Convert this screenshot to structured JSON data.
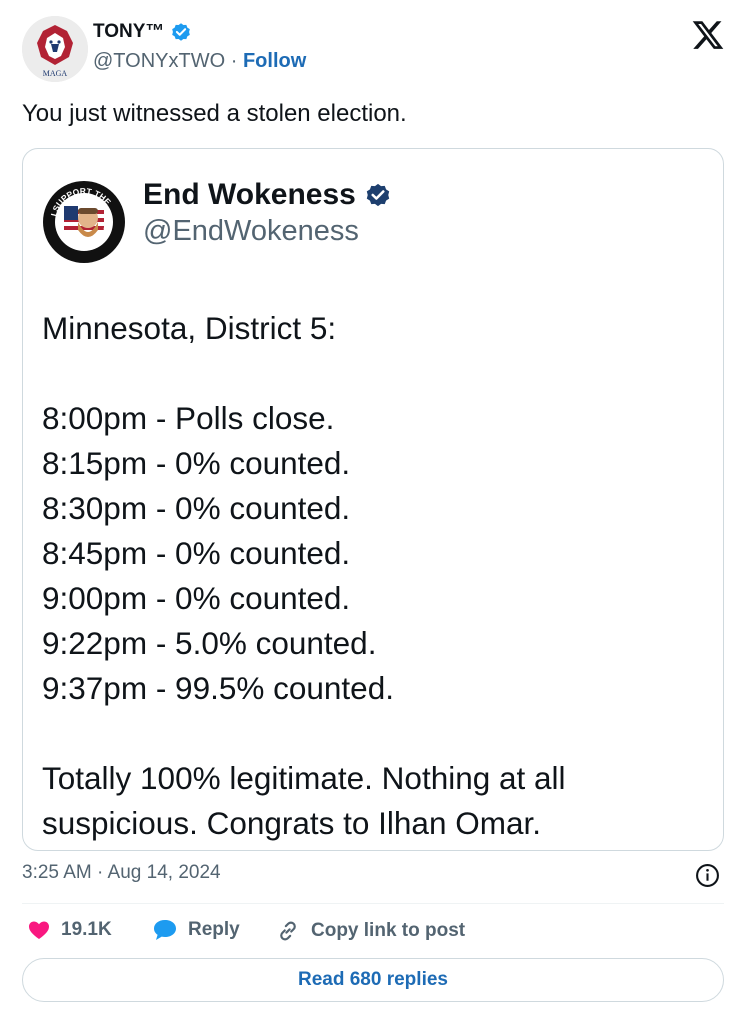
{
  "author": {
    "name": "TONY™",
    "handle": "@TONYxTWO",
    "separator": "·",
    "follow_label": "Follow",
    "avatar_caption": "MAGA"
  },
  "tweet": {
    "text": "You just witnessed a stolen election."
  },
  "quoted": {
    "name": "End Wokeness",
    "handle": "@EndWokeness",
    "avatar_text_top": "I SUPPORT THE",
    "avatar_text_bottom": "FORMER THINGS",
    "lines": [
      "Minnesota, District 5:",
      "",
      "8:00pm - Polls close.",
      "8:15pm - 0% counted.",
      "8:30pm - 0% counted.",
      "8:45pm - 0% counted.",
      "9:00pm - 0% counted.",
      "9:22pm - 5.0% counted.",
      "9:37pm - 99.5% counted.",
      "",
      "Totally 100% legitimate. Nothing at all",
      "suspicious. Congrats to Ilhan Omar."
    ]
  },
  "meta": {
    "timestamp": "3:25 AM · Aug 14, 2024"
  },
  "actions": {
    "likes": "19.1K",
    "reply_label": "Reply",
    "copy_label": "Copy link to post"
  },
  "read_replies_label": "Read 680 replies",
  "colors": {
    "accent": "#1d6bb5",
    "verified": "#1d9bf0",
    "like": "#f91880",
    "muted": "#536471"
  }
}
